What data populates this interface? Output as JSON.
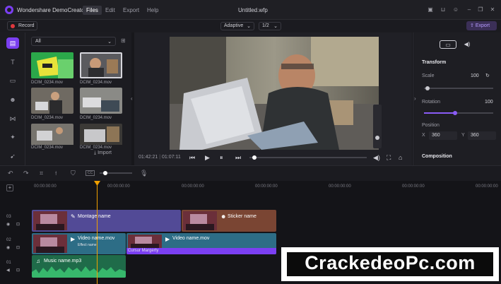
{
  "titlebar": {
    "app_name": "Wondershare DemoCreator",
    "menus": [
      "Files",
      "Edit",
      "Export",
      "Help"
    ],
    "file_title": "Untitled.wfp"
  },
  "toolbar": {
    "record_label": "Record",
    "zoom_mode": "Adaptive",
    "resolution": "1/2",
    "export_label": "Export"
  },
  "library": {
    "filter": "All",
    "items": [
      {
        "name": "DCIM_0234.mov"
      },
      {
        "name": "DCIM_0234.mov"
      },
      {
        "name": "DCIM_0234.mov"
      },
      {
        "name": "DCIM_0234.mov"
      },
      {
        "name": "DCIM_0234.mov"
      },
      {
        "name": "DCIM_0234.mov"
      }
    ],
    "import_label": "Import"
  },
  "player": {
    "current_time": "01:42:21",
    "total_time": "01:07:11",
    "progress": 0.04
  },
  "properties": {
    "transform_heading": "Transform",
    "scale_label": "Scale",
    "scale_value": "100",
    "scale_fraction": 0.05,
    "rotation_label": "Rotation",
    "rotation_value": "100",
    "rotation_fraction": 0.45,
    "position_label": "Position",
    "x_label": "X",
    "x_value": "360",
    "y_label": "Y",
    "y_value": "360",
    "composition_heading": "Composition",
    "accent_color": "#8a5cf6"
  },
  "timeline": {
    "ticks": [
      "00:00:00:00",
      "00:00:00:00",
      "00:00:00:00",
      "00:00:00:00",
      "00:00:00:00",
      "00:00:00:00",
      "00:00:00:00"
    ],
    "tracks": [
      {
        "number": "03"
      },
      {
        "number": "02"
      },
      {
        "number": "01"
      }
    ],
    "clips": {
      "montage": "Montage name",
      "sticker": "Sticker name",
      "video1": "Video name.mov",
      "video1_effect": "Effect name",
      "video2": "Video name.mov",
      "cursor": "Cursur Margerty",
      "music": "Music name.mp3"
    },
    "colors": {
      "montage": "#524a96",
      "sticker": "#7a4533",
      "video": "#2d6d86",
      "cursor": "#7b3ff2",
      "audio": "#1f6b49",
      "playhead": "#f0a000"
    }
  },
  "watermark": {
    "text": "CrackedeoPc.com"
  }
}
